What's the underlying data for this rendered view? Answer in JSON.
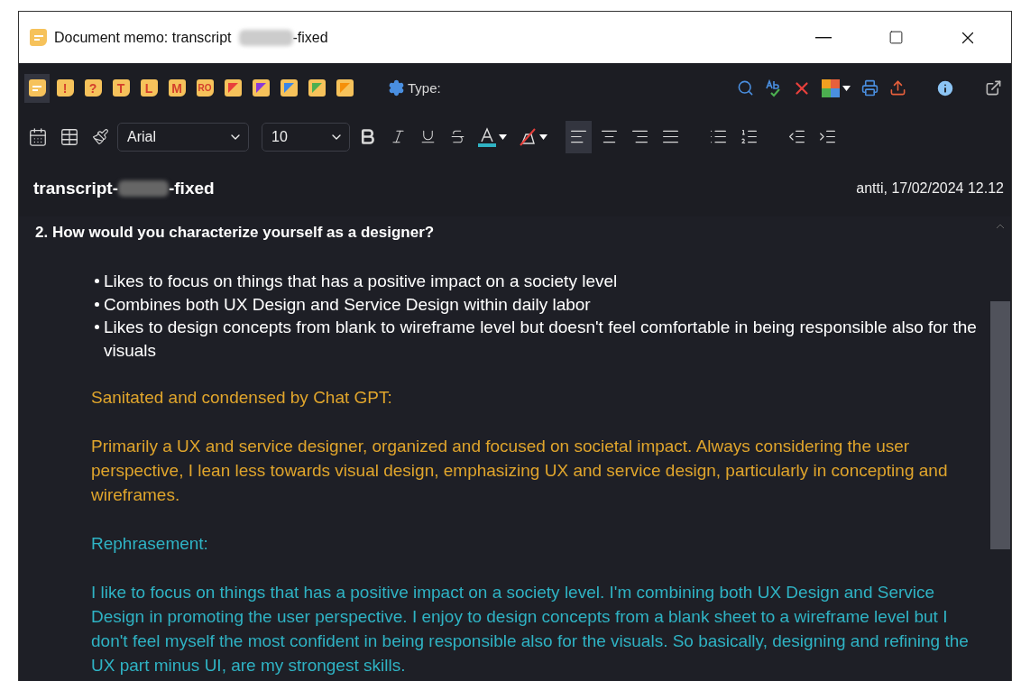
{
  "window": {
    "title_start": "Document memo: transcript",
    "title_end": "-fixed"
  },
  "memo_types": [
    {
      "kind": "plain",
      "selected": true
    },
    {
      "kind": "letter",
      "label": "!",
      "selected": false
    },
    {
      "kind": "letter",
      "label": "?",
      "selected": false
    },
    {
      "kind": "letter",
      "label": "T",
      "selected": false
    },
    {
      "kind": "letter",
      "label": "L",
      "selected": false
    },
    {
      "kind": "letter",
      "label": "M",
      "selected": false
    },
    {
      "kind": "letter",
      "label": "RO",
      "selected": false
    },
    {
      "kind": "corner",
      "color": "#e8403c",
      "selected": false
    },
    {
      "kind": "corner",
      "color": "#8a3ad8",
      "selected": false
    },
    {
      "kind": "corner",
      "color": "#3a86e8",
      "selected": false
    },
    {
      "kind": "corner",
      "color": "#4caf50",
      "selected": false
    },
    {
      "kind": "corner",
      "color": "#f5900a",
      "selected": false
    }
  ],
  "type_label": "Type:",
  "format": {
    "font": "Arial",
    "size": "10",
    "align": [
      {
        "kind": "left",
        "selected": true
      },
      {
        "kind": "center",
        "selected": false
      },
      {
        "kind": "right",
        "selected": false
      },
      {
        "kind": "justify",
        "selected": false
      }
    ]
  },
  "memo": {
    "title_start": "transcript-",
    "title_end": "-fixed",
    "meta": "antti, 17/02/2024 12.12"
  },
  "content": {
    "heading": "2. How would you characterize yourself as a designer?",
    "bullets": [
      "Likes to focus on things that has a positive impact on a society level",
      "Combines both UX Design and Service Design within daily labor",
      "Likes to design concepts from blank to wireframe level but doesn't feel comfortable in being responsible also for the visuals"
    ],
    "paragraphs": [
      {
        "color": "#e0a52c",
        "text": "Sanitated and condensed by Chat GPT:"
      },
      {
        "color": "#e0a52c",
        "text": "Primarily a UX and service designer, organized and focused on societal impact. Always considering the user perspective, I lean less towards visual design, emphasizing UX and service design, particularly in concepting and wireframes."
      },
      {
        "color": "#2fb3c4",
        "text": "Rephrasement:"
      },
      {
        "color": "#2fb3c4",
        "text": "I like to focus on things that has a positive impact on a society level. I'm combining both UX Design and Service Design in promoting the user perspective. I enjoy to design concepts from a blank sheet to a wireframe level but I don't feel myself the most confident in being responsible also for the visuals. So basically, designing and refining the UX part minus UI, are my strongest skills."
      }
    ]
  }
}
